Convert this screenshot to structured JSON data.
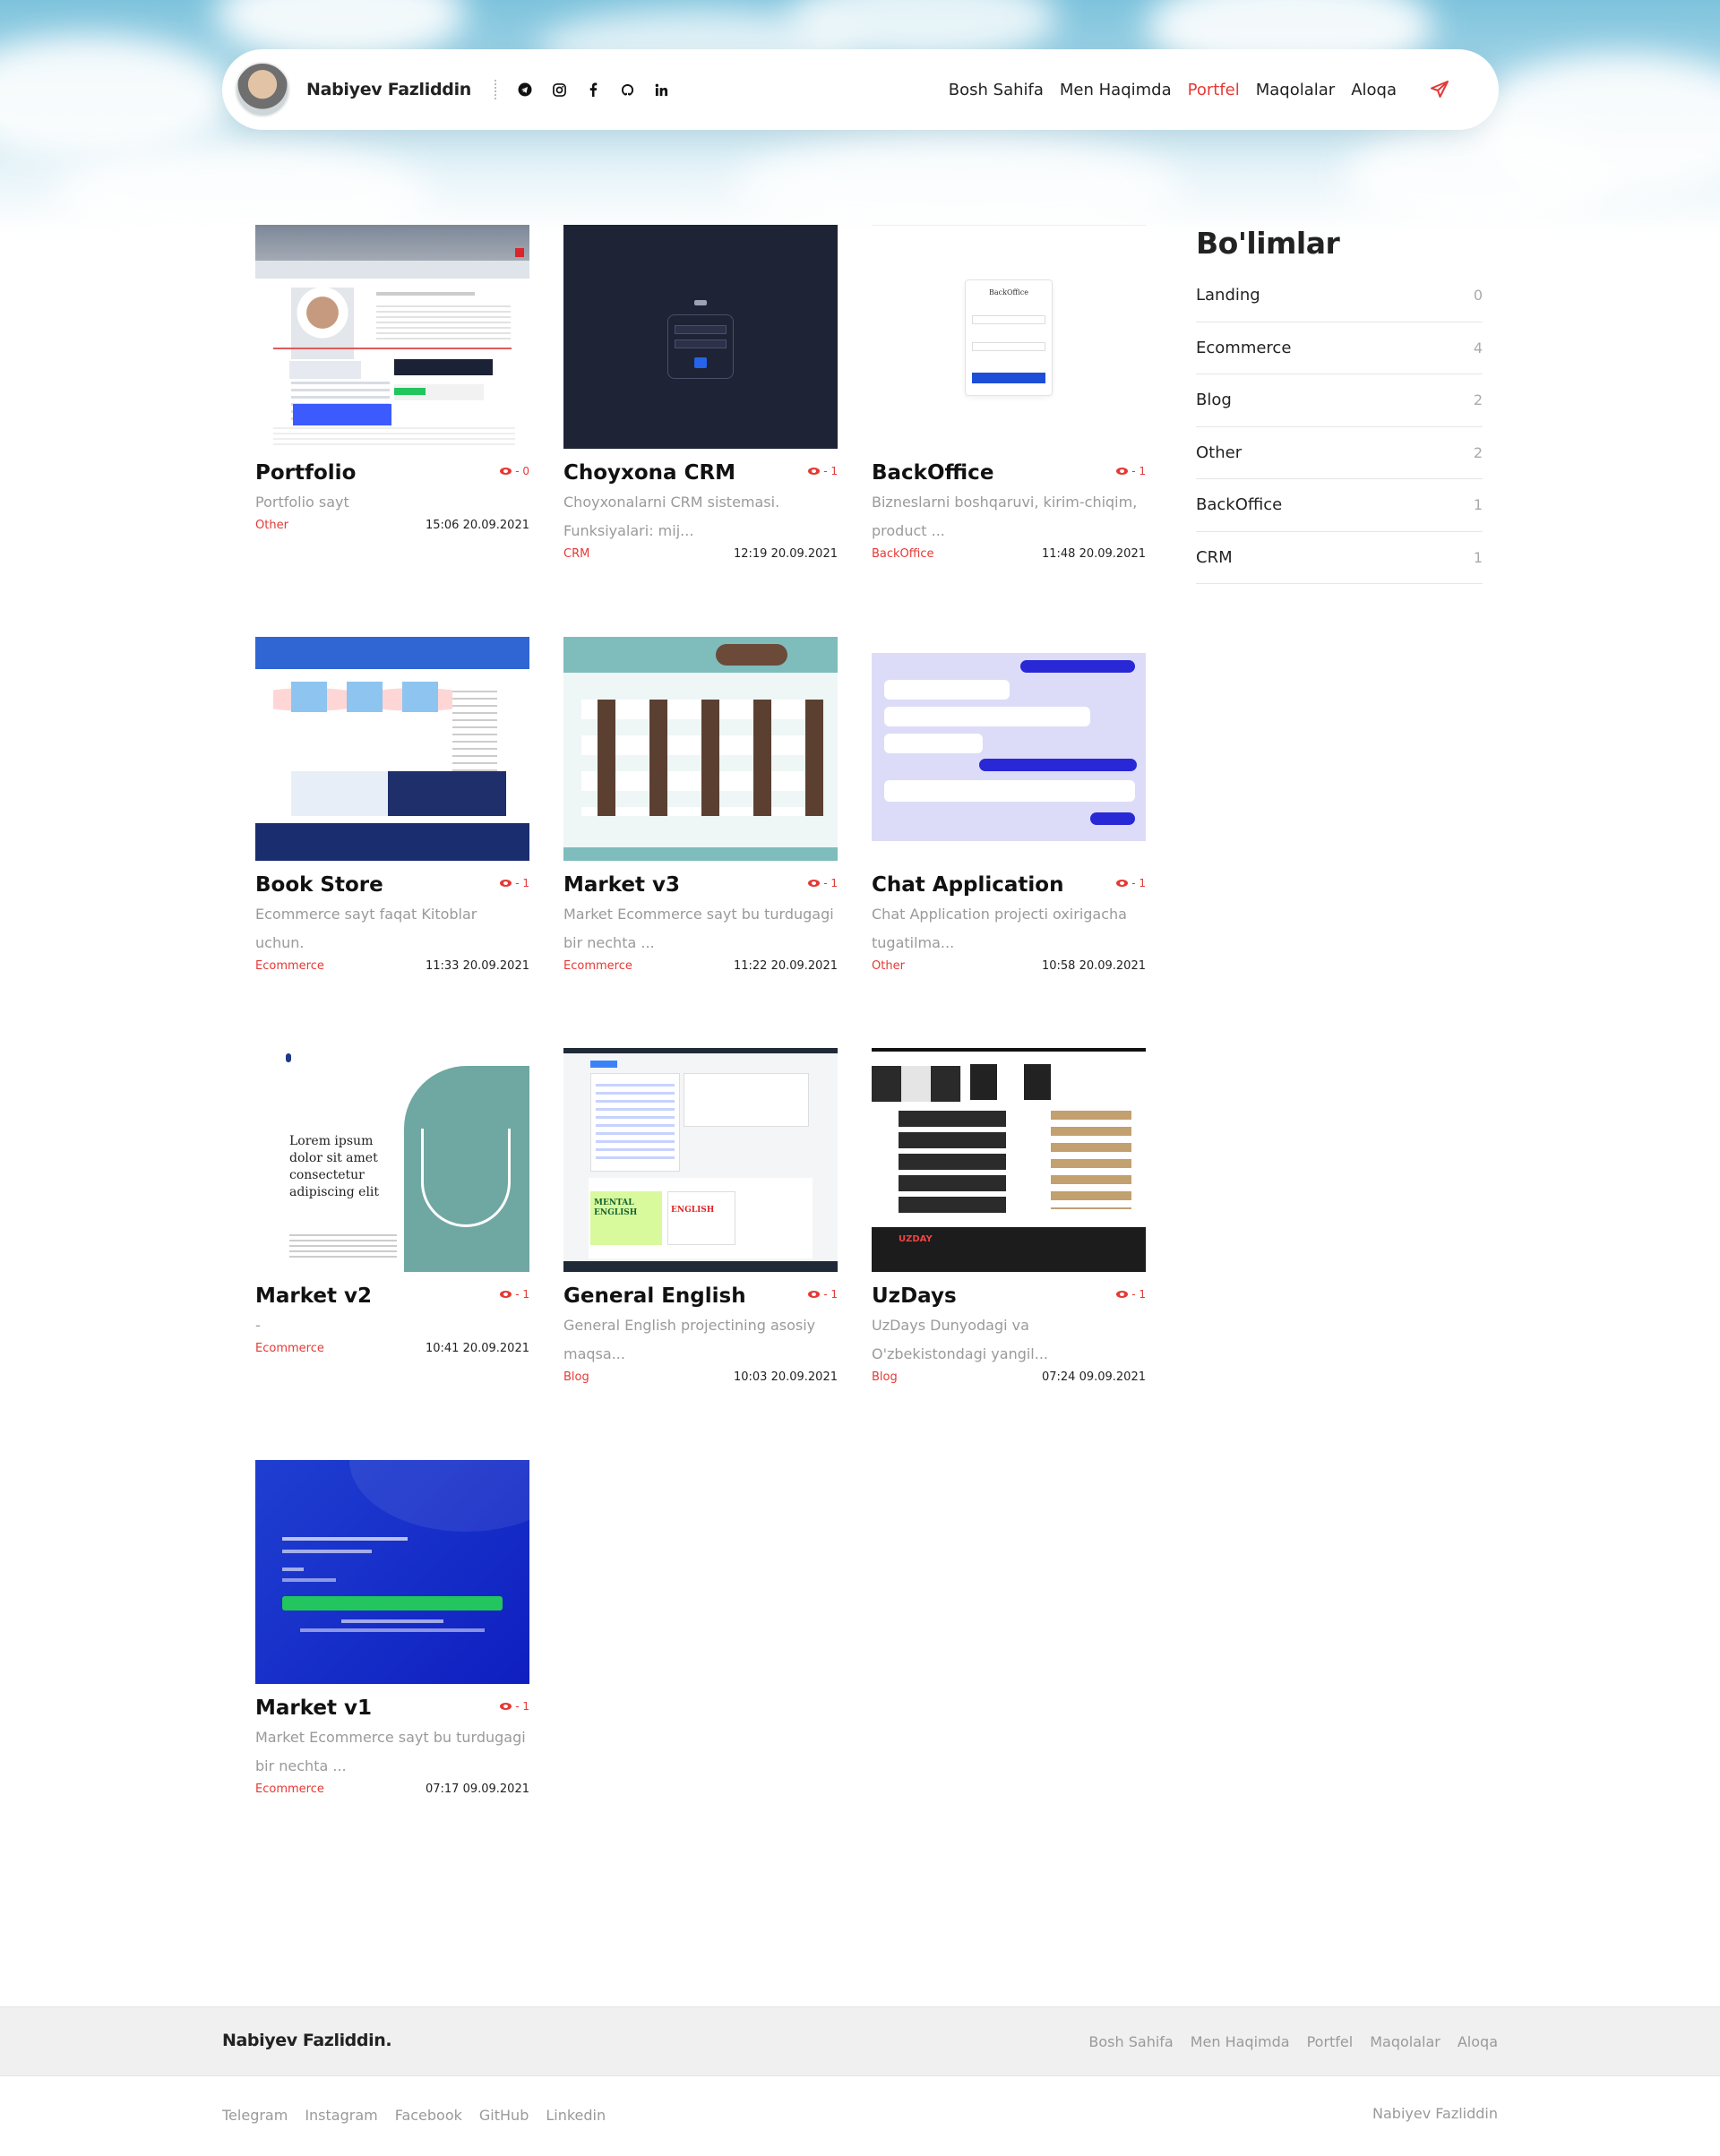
{
  "header": {
    "name": "Nabiyev Fazliddin",
    "socials": [
      "telegram-icon",
      "instagram-icon",
      "facebook-icon",
      "github-icon",
      "linkedin-icon"
    ],
    "nav": [
      {
        "label": "Bosh Sahifa",
        "active": false
      },
      {
        "label": "Men Haqimda",
        "active": false
      },
      {
        "label": "Portfel",
        "active": true
      },
      {
        "label": "Maqolalar",
        "active": false
      },
      {
        "label": "Aloqa",
        "active": false
      }
    ]
  },
  "accent_color": "#e53935",
  "projects": [
    {
      "title": "Portfolio",
      "views": "- 0",
      "desc": "Portfolio sayt",
      "category": "Other",
      "date": "15:06 20.09.2021"
    },
    {
      "title": "Choyxona CRM",
      "views": "- 1",
      "desc": "Choyxonalarni CRM sistemasi. Funksiyalari: mij...",
      "category": "CRM",
      "date": "12:19 20.09.2021"
    },
    {
      "title": "BackOffice",
      "views": "- 1",
      "desc": "Bizneslarni boshqaruvi, kirim-chiqim, product ...",
      "category": "BackOffice",
      "date": "11:48 20.09.2021"
    },
    {
      "title": "Book Store",
      "views": "- 1",
      "desc": "Ecommerce sayt faqat Kitoblar uchun.",
      "category": "Ecommerce",
      "date": "11:33 20.09.2021"
    },
    {
      "title": "Market v3",
      "views": "- 1",
      "desc": "Market Ecommerce sayt bu turdugagi bir nechta ...",
      "category": "Ecommerce",
      "date": "11:22 20.09.2021"
    },
    {
      "title": "Chat Application",
      "views": "- 1",
      "desc": "Chat Application projecti oxirigacha tugatilma...",
      "category": "Other",
      "date": "10:58 20.09.2021"
    },
    {
      "title": "Market v2",
      "views": "- 1",
      "desc": "-",
      "category": "Ecommerce",
      "date": "10:41 20.09.2021"
    },
    {
      "title": "General English",
      "views": "- 1",
      "desc": "General English projectining asosiy maqsa...",
      "category": "Blog",
      "date": "10:03 20.09.2021"
    },
    {
      "title": "UzDays",
      "views": "- 1",
      "desc": "UzDays Dunyodagi va O'zbekistondagi yangil...",
      "category": "Blog",
      "date": "07:24 09.09.2021"
    },
    {
      "title": "Market v1",
      "views": "- 1",
      "desc": "Market Ecommerce sayt bu turdugagi bir nechta ...",
      "category": "Ecommerce",
      "date": "07:17 09.09.2021"
    }
  ],
  "sidebar": {
    "title": "Bo'limlar",
    "categories": [
      {
        "name": "Landing",
        "count": "0"
      },
      {
        "name": "Ecommerce",
        "count": "4"
      },
      {
        "name": "Blog",
        "count": "2"
      },
      {
        "name": "Other",
        "count": "2"
      },
      {
        "name": "BackOffice",
        "count": "1"
      },
      {
        "name": "CRM",
        "count": "1"
      }
    ]
  },
  "thumb_text": {
    "backoffice_logo": "BackOffice",
    "market_v2_heading": "Lorem ipsum dolor sit amet consectetur adipiscing elit",
    "general_english_book1": "MENTAL ENGLISH",
    "general_english_book2": "ENGLISH",
    "uzdays_logo": "UZDAY"
  },
  "footer": {
    "brand": "Nabiyev Fazliddin.",
    "links": [
      "Bosh Sahifa",
      "Men Haqimda",
      "Portfel",
      "Maqolalar",
      "Aloqa"
    ],
    "socials": [
      "Telegram",
      "Instagram",
      "Facebook",
      "GitHub",
      "Linkedin"
    ],
    "copyright": "Nabiyev Fazliddin"
  }
}
